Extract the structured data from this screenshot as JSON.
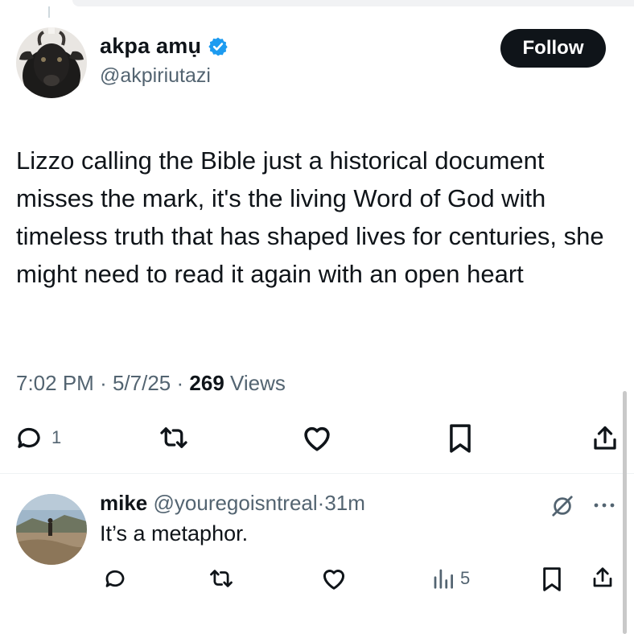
{
  "tweet": {
    "author": {
      "display_name": "akpa amụ",
      "handle": "@akpiriutazi",
      "verified": true,
      "avatar": "goat-avatar"
    },
    "follow_label": "Follow",
    "text": "Lizzo calling the Bible just a historical document misses the mark, it's the living Word of God with timeless truth that has shaped lives for centuries, she might need to read it again with an open heart",
    "time": "7:02 PM",
    "date": "5/7/25",
    "separator": "·",
    "views_count": "269",
    "views_label": "Views",
    "reply_count": "1"
  },
  "reply": {
    "display_name": "mike",
    "handle": "@youregoisntreal",
    "age": "31m",
    "text": "It’s a metaphor.",
    "views": "5",
    "avatar": "landscape-avatar"
  },
  "icons": {
    "reply": "reply-icon",
    "retweet": "retweet-icon",
    "like": "heart-icon",
    "bookmark": "bookmark-icon",
    "share": "share-icon",
    "grok": "grok-icon",
    "more": "more-icon",
    "views": "views-icon",
    "verified": "verified-badge-icon"
  },
  "colors": {
    "text": "#0f1419",
    "secondary": "#536471",
    "verified": "#1d9bf0",
    "follow_bg": "#0f1419"
  }
}
